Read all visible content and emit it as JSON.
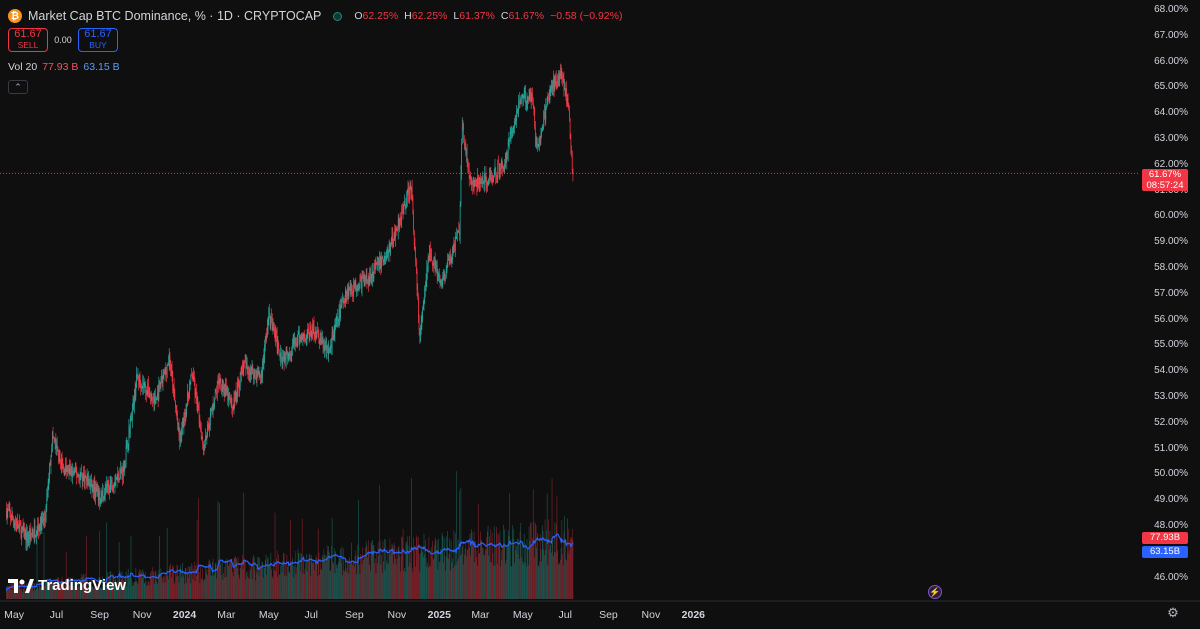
{
  "header": {
    "symbol_title": "Market Cap BTC Dominance, % · 1D · CRYPTOCAP",
    "ohlc": [
      {
        "label": "O",
        "value": "62.25%"
      },
      {
        "label": "H",
        "value": "62.25%"
      },
      {
        "label": "L",
        "value": "61.37%"
      },
      {
        "label": "C",
        "value": "61.67%"
      }
    ],
    "change": "−0.58 (−0.92%)",
    "coin_icon": "bitcoin-icon",
    "status_icon": "market-status-dot"
  },
  "trade": {
    "sell_price": "61.67",
    "sell_label": "SELL",
    "spread": "0.00",
    "buy_price": "61.67",
    "buy_label": "BUY"
  },
  "volume_legend": {
    "label": "Vol 20",
    "value": "77.93 B",
    "ma_value": "63.15 B"
  },
  "price_axis": {
    "labels": [
      "68.00%",
      "67.00%",
      "66.00%",
      "65.00%",
      "64.00%",
      "63.00%",
      "62.00%",
      "61.00%",
      "60.00%",
      "59.00%",
      "58.00%",
      "57.00%",
      "56.00%",
      "55.00%",
      "54.00%",
      "53.00%",
      "52.00%",
      "51.00%",
      "50.00%",
      "49.00%",
      "48.00%",
      "47.00%",
      "46.00%"
    ],
    "current_price": "61.67%",
    "countdown": "08:57:24",
    "volume_tag": "77.93B",
    "volume_ma_tag": "63.15B"
  },
  "time_axis": {
    "labels": [
      {
        "text": "May",
        "strong": false
      },
      {
        "text": "Jul",
        "strong": false
      },
      {
        "text": "Sep",
        "strong": false
      },
      {
        "text": "Nov",
        "strong": false
      },
      {
        "text": "2024",
        "strong": true
      },
      {
        "text": "Mar",
        "strong": false
      },
      {
        "text": "May",
        "strong": false
      },
      {
        "text": "Jul",
        "strong": false
      },
      {
        "text": "Sep",
        "strong": false
      },
      {
        "text": "Nov",
        "strong": false
      },
      {
        "text": "2025",
        "strong": true
      },
      {
        "text": "Mar",
        "strong": false
      },
      {
        "text": "May",
        "strong": false
      },
      {
        "text": "Jul",
        "strong": false
      },
      {
        "text": "Sep",
        "strong": false
      },
      {
        "text": "Nov",
        "strong": false
      },
      {
        "text": "2026",
        "strong": true
      }
    ]
  },
  "branding": {
    "logo_text": "TradingView"
  },
  "colors": {
    "up": "#26a69a",
    "down": "#f23645",
    "volume_ma": "#2962ff",
    "background": "#0f0f0f"
  },
  "chart_data": {
    "type": "candlestick",
    "interval": "1D",
    "ylim": [
      45.5,
      68.2
    ],
    "x_range": [
      "2023-04-18",
      "2026-01-20"
    ],
    "approx_close_path": [
      {
        "date": "2023-04-20",
        "value": 48.6
      },
      {
        "date": "2023-05-20",
        "value": 47.5
      },
      {
        "date": "2023-06-15",
        "value": 48.3
      },
      {
        "date": "2023-06-25",
        "value": 51.5
      },
      {
        "date": "2023-07-10",
        "value": 50.2
      },
      {
        "date": "2023-08-10",
        "value": 49.9
      },
      {
        "date": "2023-09-01",
        "value": 49.1
      },
      {
        "date": "2023-10-05",
        "value": 50.2
      },
      {
        "date": "2023-10-25",
        "value": 53.8
      },
      {
        "date": "2023-11-20",
        "value": 52.8
      },
      {
        "date": "2023-12-10",
        "value": 54.5
      },
      {
        "date": "2023-12-25",
        "value": 51.3
      },
      {
        "date": "2024-01-12",
        "value": 53.9
      },
      {
        "date": "2024-01-28",
        "value": 51.1
      },
      {
        "date": "2024-02-20",
        "value": 53.7
      },
      {
        "date": "2024-03-10",
        "value": 52.6
      },
      {
        "date": "2024-03-25",
        "value": 54.2
      },
      {
        "date": "2024-04-20",
        "value": 53.8
      },
      {
        "date": "2024-05-01",
        "value": 56.2
      },
      {
        "date": "2024-05-20",
        "value": 54.5
      },
      {
        "date": "2024-06-15",
        "value": 55.3
      },
      {
        "date": "2024-07-05",
        "value": 55.6
      },
      {
        "date": "2024-07-25",
        "value": 54.7
      },
      {
        "date": "2024-08-20",
        "value": 57.1
      },
      {
        "date": "2024-09-20",
        "value": 57.6
      },
      {
        "date": "2024-10-20",
        "value": 58.6
      },
      {
        "date": "2024-11-12",
        "value": 60.5
      },
      {
        "date": "2024-11-22",
        "value": 61.1
      },
      {
        "date": "2024-12-04",
        "value": 55.2
      },
      {
        "date": "2024-12-18",
        "value": 58.8
      },
      {
        "date": "2025-01-03",
        "value": 57.3
      },
      {
        "date": "2025-01-30",
        "value": 59.4
      },
      {
        "date": "2025-02-03",
        "value": 63.6
      },
      {
        "date": "2025-02-15",
        "value": 61.2
      },
      {
        "date": "2025-03-12",
        "value": 61.4
      },
      {
        "date": "2025-04-05",
        "value": 62.1
      },
      {
        "date": "2025-04-25",
        "value": 64.4
      },
      {
        "date": "2025-05-15",
        "value": 64.8
      },
      {
        "date": "2025-05-20",
        "value": 62.5
      },
      {
        "date": "2025-06-10",
        "value": 64.9
      },
      {
        "date": "2025-06-25",
        "value": 65.7
      },
      {
        "date": "2025-07-05",
        "value": 64.3
      },
      {
        "date": "2025-07-12",
        "value": 61.7
      }
    ],
    "current_close": 61.67,
    "volume": {
      "last_value_billions": 77.93,
      "ma_period": 20,
      "ma_last_billions": 63.15
    }
  }
}
